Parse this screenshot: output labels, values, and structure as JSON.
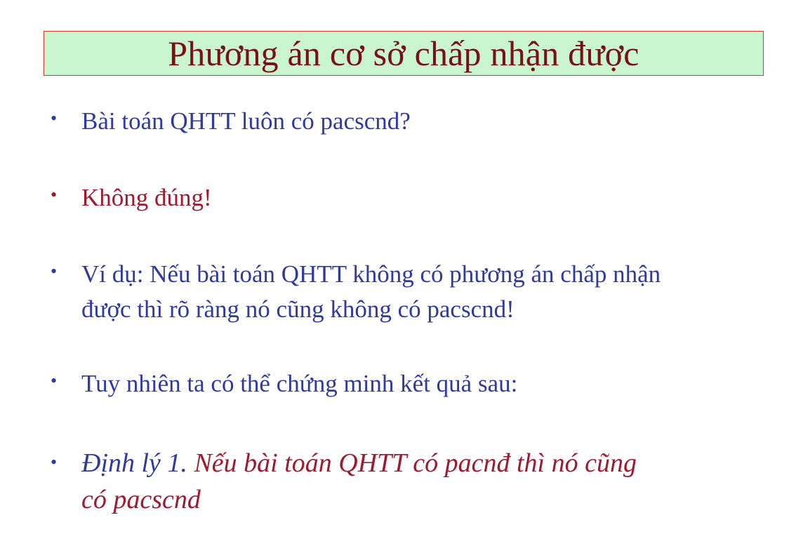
{
  "slide": {
    "title": "Phương án cơ sở chấp nhận được",
    "bullet_symbol": "•",
    "bullets": [
      {
        "text": "Bài toán QHTT luôn có pacscnd?"
      },
      {
        "text": "Không đúng!"
      },
      {
        "text_line1": "Ví dụ: Nếu bài toán QHTT không có phương án chấp nhận",
        "text_line2": "được thì rõ ràng nó cũng không có pacscnd!"
      },
      {
        "text": "Tuy nhiên ta có thể chứng minh kết quả sau:"
      },
      {
        "label": "Định lý 1.",
        "text_line1": " Nếu bài toán QHTT có pacnđ thì nó cũng",
        "text_line2": "có pacscnd"
      }
    ]
  },
  "colors": {
    "title_bg": "#c9f5cf",
    "title_border": "#d23a2a",
    "title_text": "#7a0f16",
    "blue_text": "#2e3a9e",
    "red_text": "#9e1b2f"
  }
}
